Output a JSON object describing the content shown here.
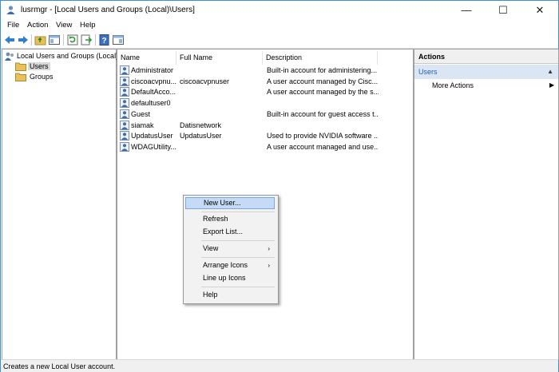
{
  "window": {
    "title": "lusrmgr - [Local Users and Groups (Local)\\Users]",
    "controls": {
      "minimize": "—",
      "maximize": "☐",
      "close": "✕"
    }
  },
  "menu": {
    "file": "File",
    "action": "Action",
    "view": "View",
    "help": "Help"
  },
  "toolbar": {
    "icons": [
      "back-icon",
      "forward-icon",
      "up-folder-icon",
      "show-hide-tree-icon",
      "refresh-icon",
      "export-list-icon",
      "help-icon",
      "properties-icon"
    ]
  },
  "tree": {
    "root": "Local Users and Groups (Local)",
    "items": [
      {
        "label": "Users",
        "selected": true
      },
      {
        "label": "Groups",
        "selected": false
      }
    ]
  },
  "list": {
    "columns": {
      "name": "Name",
      "full_name": "Full Name",
      "description": "Description"
    },
    "rows": [
      {
        "name": "Administrator",
        "full_name": "",
        "description": "Built-in account for administering..."
      },
      {
        "name": "ciscoacvpnu...",
        "full_name": "ciscoacvpnuser",
        "description": "A user account managed by Cisc..."
      },
      {
        "name": "DefaultAcco...",
        "full_name": "",
        "description": "A user account managed by the s..."
      },
      {
        "name": "defaultuser0",
        "full_name": "",
        "description": ""
      },
      {
        "name": "Guest",
        "full_name": "",
        "description": "Built-in account for guest access t..."
      },
      {
        "name": "siamak",
        "full_name": "Datisnetwork",
        "description": ""
      },
      {
        "name": "UpdatusUser",
        "full_name": "UpdatusUser",
        "description": "Used to provide NVIDIA software ..."
      },
      {
        "name": "WDAGUtility...",
        "full_name": "",
        "description": "A user account managed and use..."
      }
    ]
  },
  "actions": {
    "title": "Actions",
    "section": "Users",
    "more": "More Actions"
  },
  "context_menu": {
    "items": [
      {
        "label": "New User...",
        "highlighted": true
      },
      {
        "label": "Refresh"
      },
      {
        "label": "Export List..."
      },
      {
        "label": "View",
        "submenu": true
      },
      {
        "label": "Arrange Icons",
        "submenu": true
      },
      {
        "label": "Line up Icons"
      },
      {
        "label": "Help"
      }
    ]
  },
  "status": {
    "text": "Creates a new Local User account."
  },
  "colors": {
    "accent": "#3c8fd8",
    "selection": "#c5daf5",
    "folder": "#e8c15a"
  }
}
